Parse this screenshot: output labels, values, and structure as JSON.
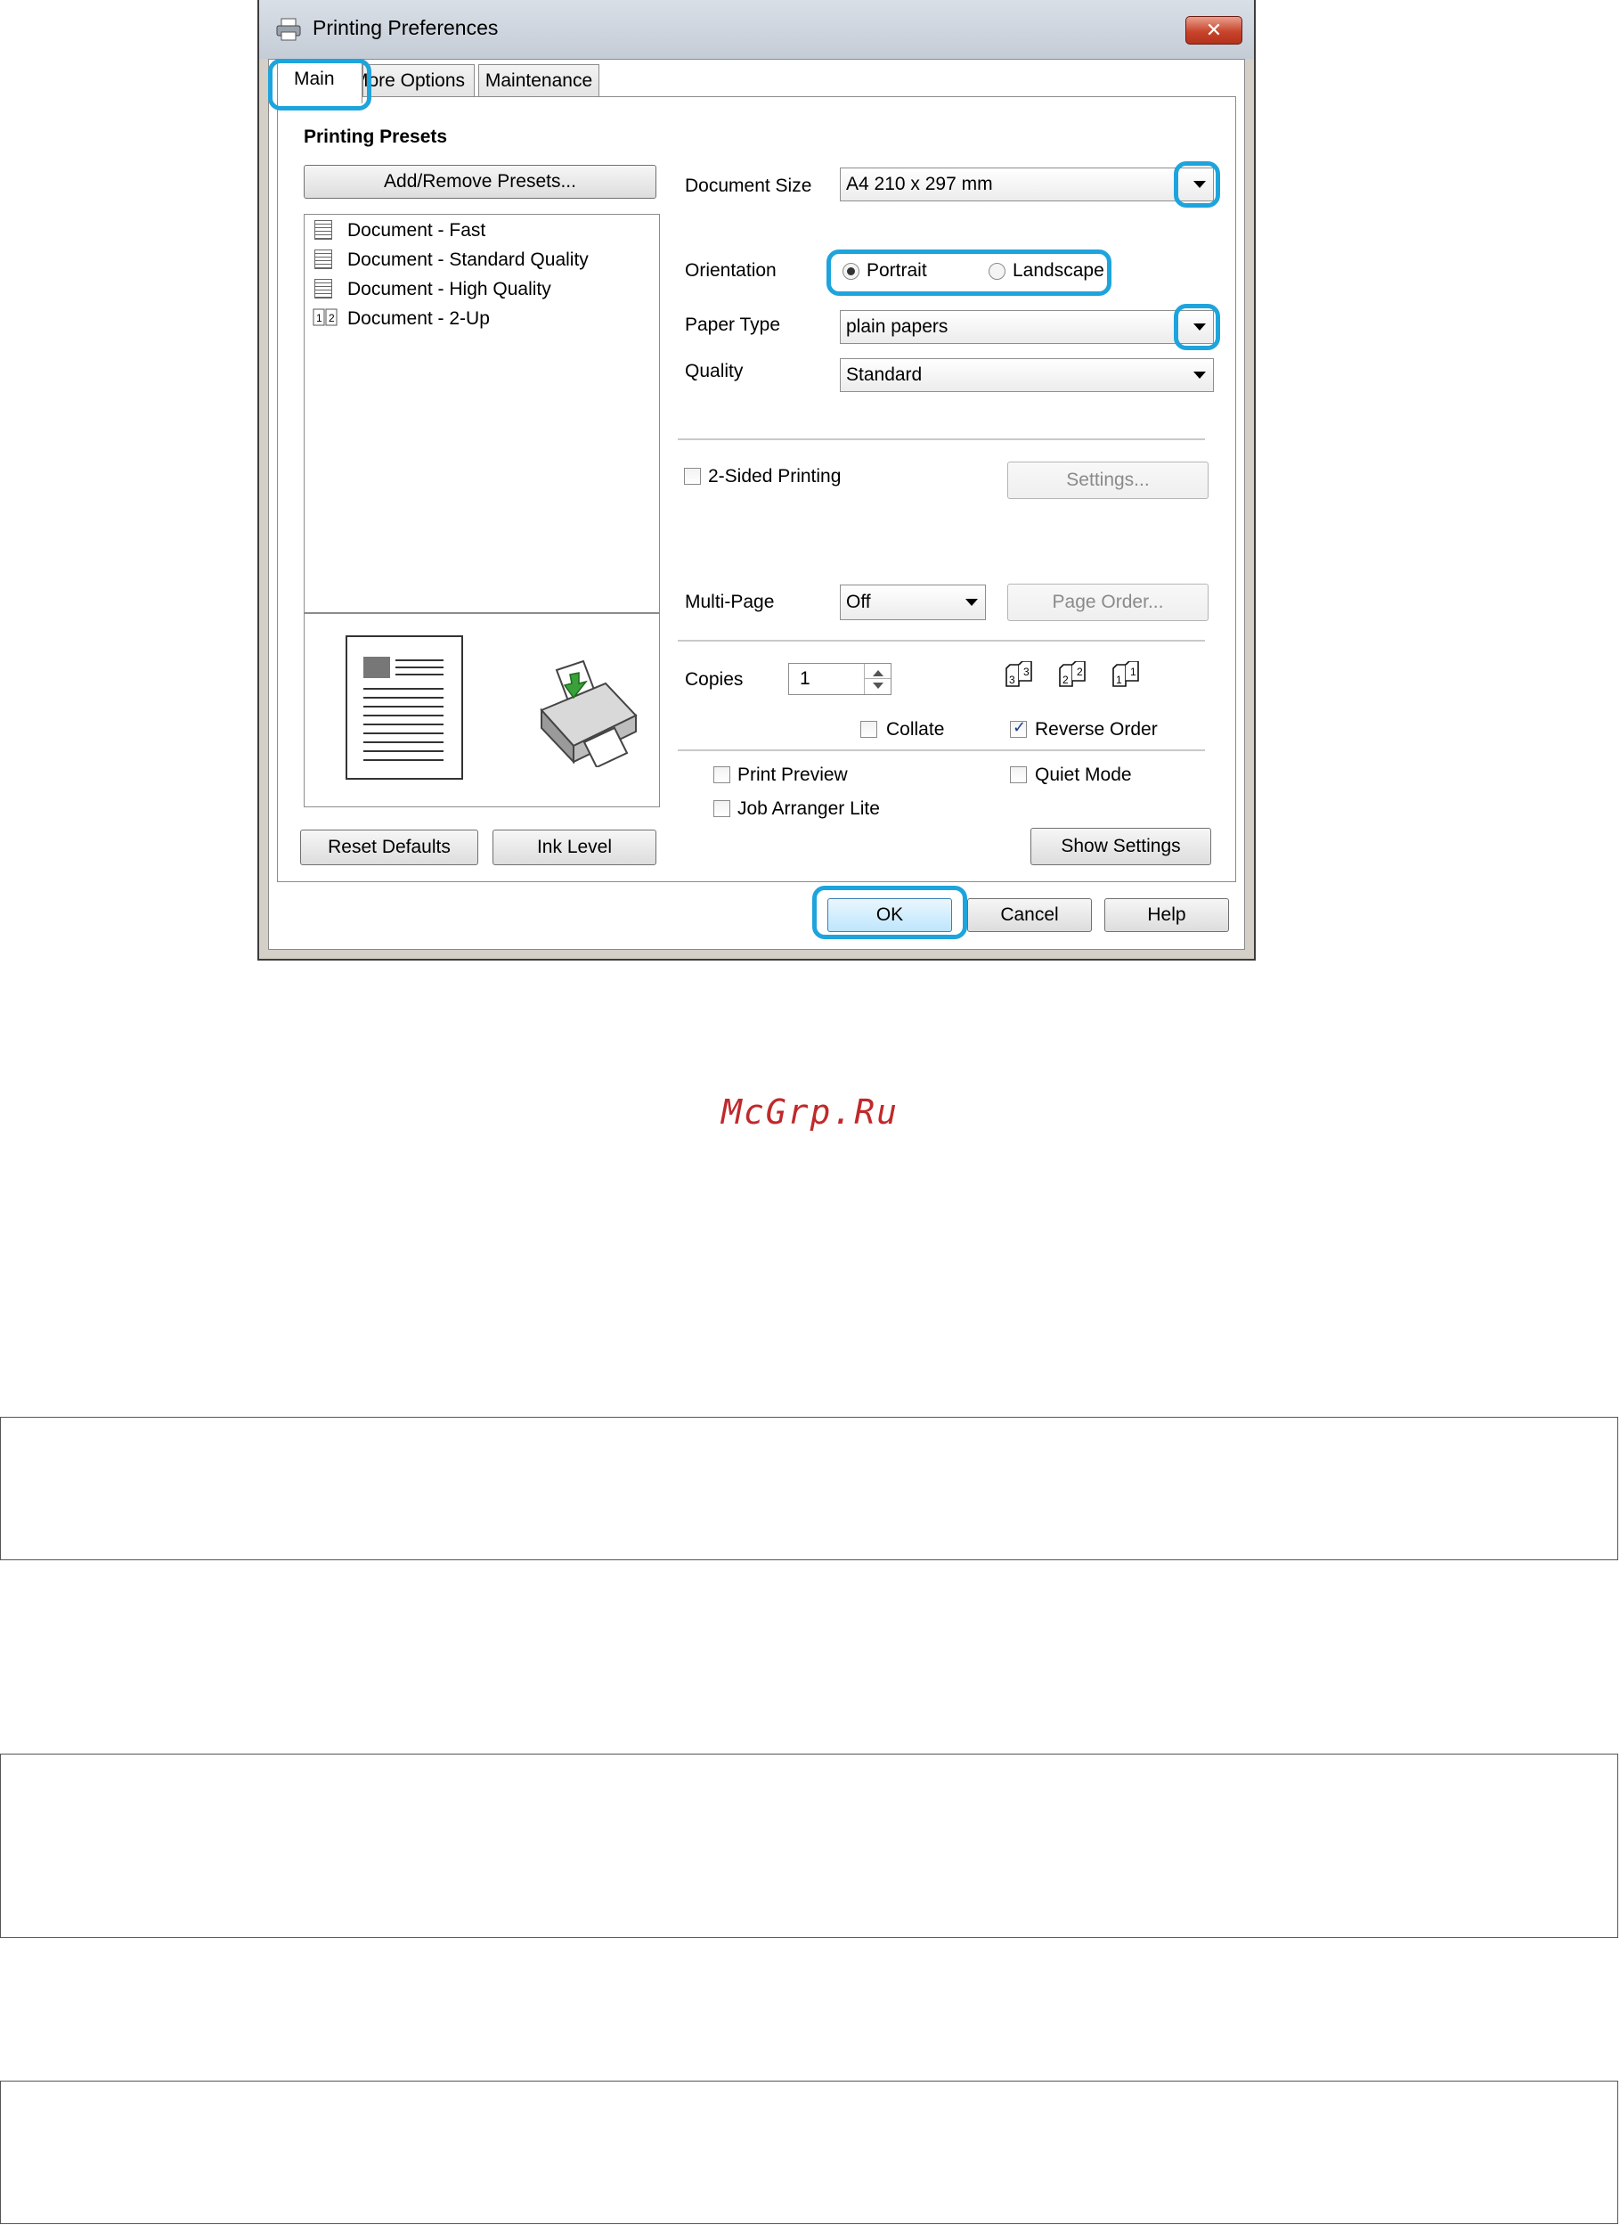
{
  "window": {
    "title": "Printing Preferences",
    "close_glyph": "✕"
  },
  "tabs": [
    {
      "label": "Main",
      "selected": true
    },
    {
      "label": "More Options",
      "selected": false
    },
    {
      "label": "Maintenance",
      "selected": false
    }
  ],
  "presets": {
    "heading": "Printing Presets",
    "add_remove_label": "Add/Remove Presets...",
    "items": [
      {
        "label": "Document - Fast",
        "icon": "document-icon"
      },
      {
        "label": "Document - Standard Quality",
        "icon": "document-icon"
      },
      {
        "label": "Document - High Quality",
        "icon": "document-icon"
      },
      {
        "label": "Document - 2-Up",
        "icon": "two-up-icon"
      }
    ]
  },
  "settings": {
    "document_size": {
      "label": "Document Size",
      "value": "A4 210 x 297 mm"
    },
    "orientation": {
      "label": "Orientation",
      "portrait": "Portrait",
      "landscape": "Landscape",
      "selected": "Portrait"
    },
    "paper_type": {
      "label": "Paper Type",
      "value": "plain papers"
    },
    "quality": {
      "label": "Quality",
      "value": "Standard"
    },
    "two_sided": {
      "label": "2-Sided Printing",
      "checked": false,
      "settings_button": "Settings..."
    },
    "multi_page": {
      "label": "Multi-Page",
      "value": "Off",
      "page_order_button": "Page Order..."
    },
    "copies": {
      "label": "Copies",
      "value": "1"
    },
    "collate": {
      "label": "Collate",
      "checked": false
    },
    "reverse_order": {
      "label": "Reverse Order",
      "checked": true
    },
    "print_preview": {
      "label": "Print Preview",
      "checked": false
    },
    "quiet_mode": {
      "label": "Quiet Mode",
      "checked": false
    },
    "job_arranger": {
      "label": "Job Arranger Lite",
      "checked": false
    },
    "copy_icons": [
      "3",
      "2",
      "1"
    ]
  },
  "buttons": {
    "reset_defaults": "Reset Defaults",
    "ink_level": "Ink Level",
    "show_settings": "Show Settings",
    "ok": "OK",
    "cancel": "Cancel",
    "help": "Help"
  },
  "colors": {
    "highlight": "#1ea4dc",
    "watermark": "#c0292b",
    "close_button": "#c8452c"
  },
  "watermark": "McGrp.Ru"
}
